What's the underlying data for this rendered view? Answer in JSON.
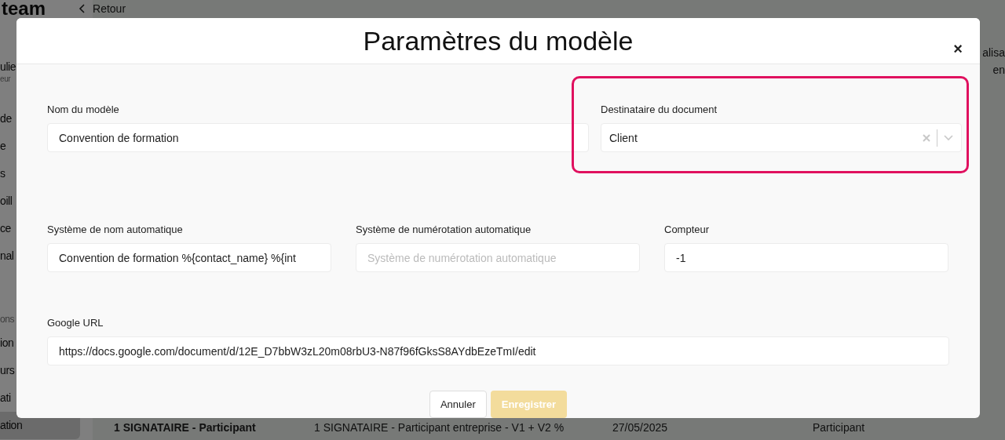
{
  "app": {
    "logo": "team",
    "back_link": "Retour"
  },
  "sidebar": {
    "items": [
      {
        "label": "ulie",
        "kind": "title",
        "selected": false
      },
      {
        "label": "eur",
        "kind": "subtitle",
        "selected": false
      },
      {
        "label": "de",
        "kind": "item",
        "selected": false
      },
      {
        "label": "e",
        "kind": "item",
        "selected": false
      },
      {
        "label": "s",
        "kind": "item",
        "selected": false
      },
      {
        "label": "oill",
        "kind": "item",
        "selected": false
      },
      {
        "label": "ce",
        "kind": "item",
        "selected": false
      },
      {
        "label": "nal",
        "kind": "item",
        "selected": false
      },
      {
        "label": "ons",
        "kind": "section",
        "selected": false
      },
      {
        "label": "ion",
        "kind": "item",
        "selected": false
      },
      {
        "label": "urs",
        "kind": "item",
        "selected": false
      },
      {
        "label": "ati",
        "kind": "item",
        "selected": false
      },
      {
        "label": "ation",
        "kind": "item",
        "selected": true
      }
    ]
  },
  "table": {
    "header_fragments": [
      "alisa",
      "en"
    ],
    "rows": [
      {
        "cells": [
          "1 SIGNATAIRE - Participant",
          "1 SIGNATAIRE - Participant entreprise - V1 + V2 %",
          "27/05/2025",
          "Participant"
        ]
      }
    ]
  },
  "modal": {
    "title": "Paramètres du modèle",
    "close": "×",
    "fields": [
      {
        "label": "Nom du modèle",
        "kind": "text",
        "value": "Convention de formation"
      },
      {
        "label": "Destinataire du document",
        "kind": "select",
        "value": "Client",
        "highlighted": true
      },
      {
        "label": "Système de nom automatique",
        "kind": "text",
        "value": "Convention de formation %{contact_name} %{int"
      },
      {
        "label": "Système de numérotation automatique",
        "kind": "text",
        "placeholder": "Système de numérotation automatique"
      },
      {
        "label": "Compteur",
        "kind": "text",
        "value": "-1"
      },
      {
        "label": "Google URL",
        "kind": "text",
        "value": "https://docs.google.com/document/d/12E_D7bbW3zL20m08rbU3-N87f96fGksS8AYdbEzeTmI/edit"
      }
    ],
    "buttons": [
      {
        "label": "Annuler",
        "kind": "secondary",
        "disabled": false
      },
      {
        "label": "Enregistrer",
        "kind": "primary",
        "disabled": true
      }
    ]
  }
}
